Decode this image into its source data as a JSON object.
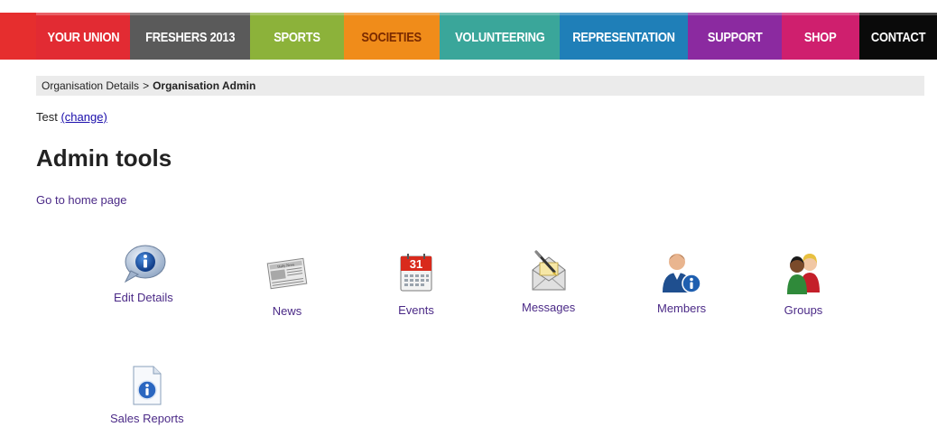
{
  "nav": {
    "tabs": [
      {
        "label": "YOUR UNION",
        "bg": "#e22b33",
        "fg": "#ffffff"
      },
      {
        "label": "FRESHERS 2013",
        "bg": "#5a5a5a",
        "fg": "#ffffff"
      },
      {
        "label": "SPORTS",
        "bg": "#8cb23a",
        "fg": "#ffffff"
      },
      {
        "label": "SOCIETIES",
        "bg": "#f08c1a",
        "fg": "#7a2a00"
      },
      {
        "label": "VOLUNTEERING",
        "bg": "#3aa69a",
        "fg": "#ffffff"
      },
      {
        "label": "REPRESENTATION",
        "bg": "#1f7fb8",
        "fg": "#ffffff"
      },
      {
        "label": "SUPPORT",
        "bg": "#8b2aa0",
        "fg": "#ffffff"
      },
      {
        "label": "SHOP",
        "bg": "#cf1f6e",
        "fg": "#ffffff"
      },
      {
        "label": "CONTACT",
        "bg": "#0a0a0a",
        "fg": "#ffffff"
      }
    ]
  },
  "breadcrumb": {
    "parent": "Organisation Details",
    "separator": ">",
    "current": "Organisation Admin"
  },
  "org": {
    "name": "Test",
    "change_label": "(change)"
  },
  "page": {
    "title": "Admin tools",
    "home_link": "Go to home page"
  },
  "tools": [
    {
      "label": "Edit Details",
      "icon": "info-bubble-icon"
    },
    {
      "label": "News",
      "icon": "newspaper-icon"
    },
    {
      "label": "Events",
      "icon": "calendar-icon"
    },
    {
      "label": "Messages",
      "icon": "envelope-pen-icon"
    },
    {
      "label": "Members",
      "icon": "member-info-icon"
    },
    {
      "label": "Groups",
      "icon": "group-people-icon"
    },
    {
      "label": "Sales Reports",
      "icon": "report-document-icon"
    }
  ],
  "icon_text": {
    "calendar_day": "31",
    "newspaper_masthead": "Daily News"
  }
}
